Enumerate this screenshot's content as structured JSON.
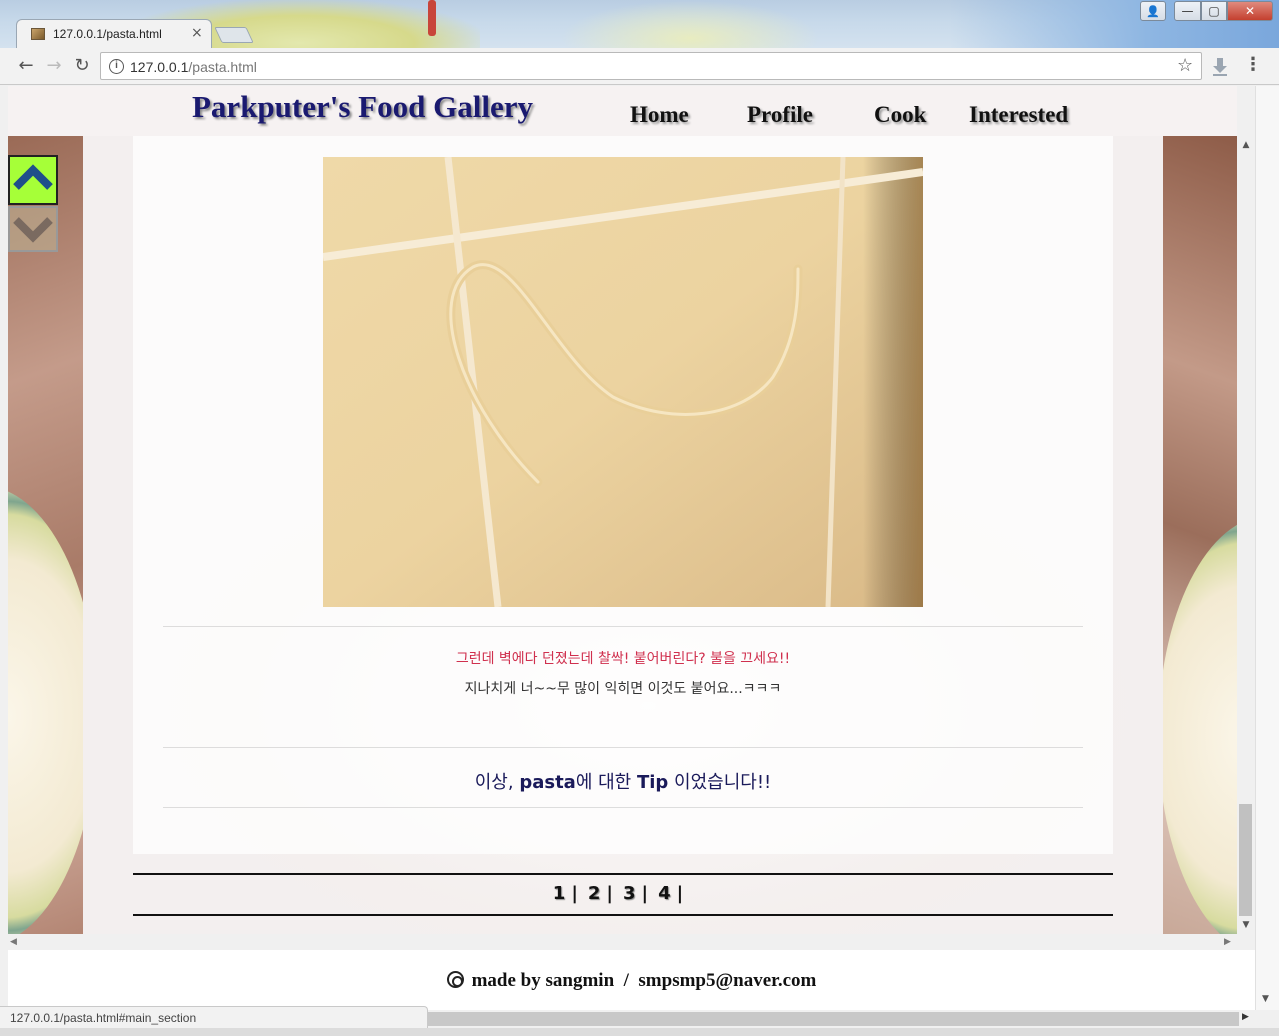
{
  "browser": {
    "tab_title": "127.0.0.1/pasta.html",
    "tab_close": "×",
    "url_host": "127.0.0.1",
    "url_path": "/pasta.html",
    "status_text": "127.0.0.1/pasta.html#main_section",
    "icons": {
      "back": "back-arrow-icon",
      "forward": "forward-arrow-icon",
      "reload": "reload-icon",
      "info": "info-icon",
      "star": "bookmark-star-icon",
      "download": "download-icon",
      "menu": "kebab-menu-icon"
    },
    "glyphs": {
      "back": "←",
      "forward": "→",
      "reload": "↻",
      "info": "i",
      "star": "☆",
      "menu": "⋮",
      "minimize": "—",
      "maximize": "▢",
      "close": "✕",
      "user": "👤",
      "scroll_up": "▲",
      "scroll_down": "▼",
      "scroll_left": "◀",
      "scroll_right": "▶"
    }
  },
  "site": {
    "title": "Parkputer's Food Gallery",
    "nav": [
      "Home",
      "Profile",
      "Cook",
      "Interested"
    ]
  },
  "main": {
    "caption_tip": "그런데 벽에다 던졌는데 찰싹! 붙어버린다? 불을 끄세요!!",
    "caption_note": "지나치게 너~~무 많이 익히면 이것도 붙어요...ㅋㅋㅋ",
    "tip_before": "이상, ",
    "tip_word1": "pasta",
    "tip_middle": "에 대한 ",
    "tip_word2": "Tip",
    "tip_after": " 이었습니다!!"
  },
  "pager": {
    "pages": [
      "1",
      "2",
      "3",
      "4"
    ],
    "separator": "|"
  },
  "footer": {
    "text": "made by sangmin  /  smpsmp5@naver.com"
  },
  "colors": {
    "title": "#1a1a70",
    "caption_tip": "#d0304e",
    "scroll_up_bg": "#a6ff38",
    "scroll_arrow": "#1f4f8a"
  }
}
